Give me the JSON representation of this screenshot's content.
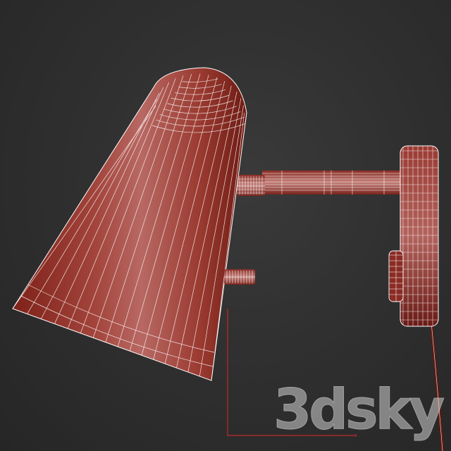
{
  "render": {
    "background": "#2e2e2e",
    "mesh_color": "#8e2a22",
    "mesh_highlight": "#b7615c",
    "wire_color": "#ffffff",
    "construction_line_color": "#c0282a"
  },
  "watermark": {
    "label": "3dsky",
    "kind": "logo"
  },
  "objects": [
    {
      "name": "lamp-shade",
      "kind": "conical shade"
    },
    {
      "name": "shade-knob",
      "kind": "small cylinder"
    },
    {
      "name": "connector",
      "kind": "cylinder"
    },
    {
      "name": "arm",
      "kind": "horizontal rod"
    },
    {
      "name": "wall-plate",
      "kind": "rounded box"
    },
    {
      "name": "switch",
      "kind": "rounded box"
    },
    {
      "name": "cord",
      "kind": "cable"
    }
  ]
}
